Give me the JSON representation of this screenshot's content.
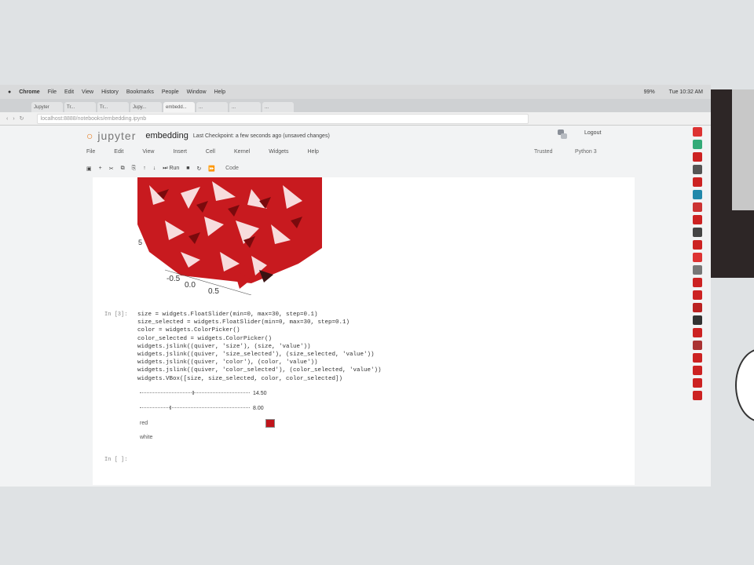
{
  "mac_menubar": {
    "app": "Chrome",
    "items": [
      "File",
      "Edit",
      "View",
      "History",
      "Bookmarks",
      "People",
      "Window",
      "Help"
    ],
    "status": [
      "99%",
      "Tue 10:32 AM"
    ]
  },
  "browser": {
    "tabs": [
      {
        "label": "Jupyter",
        "active": false
      },
      {
        "label": "Tr...",
        "active": false
      },
      {
        "label": "Tr...",
        "active": false
      },
      {
        "label": "Jupy...",
        "active": false
      },
      {
        "label": "embedd...",
        "active": true
      },
      {
        "label": "...",
        "active": false
      },
      {
        "label": "...",
        "active": false
      },
      {
        "label": "...",
        "active": false
      }
    ],
    "url": "localhost:8888/notebooks/embedding.ipynb"
  },
  "jupyter": {
    "logo_text": "jupyter",
    "notebook_name": "embedding",
    "checkpoint": "Last Checkpoint: a few seconds ago  (unsaved changes)",
    "logout": "Logout",
    "menu": [
      "File",
      "Edit",
      "View",
      "Insert",
      "Cell",
      "Kernel",
      "Widgets",
      "Help"
    ],
    "trusted": "Trusted",
    "kernel": "Python 3",
    "toolbar": {
      "run_label": "Run",
      "cell_type": "Code"
    }
  },
  "plot": {
    "axis_labels": [
      {
        "text": "5",
        "role": "y-tick"
      },
      {
        "text": "-0.5",
        "role": "x-tick"
      },
      {
        "text": "0.0",
        "role": "x-tick"
      },
      {
        "text": "0.5",
        "role": "x-tick"
      }
    ],
    "marker_color": "#c0141b"
  },
  "cell": {
    "prompt_in": "In [3]:",
    "code_lines": [
      "size = widgets.FloatSlider(min=0, max=30, step=0.1)",
      "size_selected = widgets.FloatSlider(min=0, max=30, step=0.1)",
      "color = widgets.ColorPicker()",
      "color_selected = widgets.ColorPicker()",
      "widgets.jslink((quiver, 'size'), (size, 'value'))",
      "widgets.jslink((quiver, 'size_selected'), (size_selected, 'value'))",
      "widgets.jslink((quiver, 'color'), (color, 'value'))",
      "widgets.jslink((quiver, 'color_selected'), (color_selected, 'value'))",
      "widgets.VBox([size, size_selected, color, color_selected])"
    ],
    "widgets": {
      "slider1_value": "14.50",
      "slider1_fraction": 0.48,
      "slider2_value": "8.00",
      "slider2_fraction": 0.27,
      "color_label": "red",
      "color_value": "#c0141b",
      "color2_label": "white"
    },
    "prompt_next": "In [ ]:"
  }
}
